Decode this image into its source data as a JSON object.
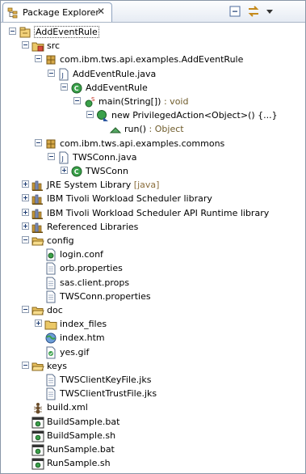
{
  "view": {
    "title": "Package Explorer",
    "close_glyph": "✕"
  },
  "toolbar": [
    "collapse-all-icon",
    "link-with-editor-icon",
    "view-menu-icon"
  ],
  "tree": [
    {
      "label": "AddEventRule",
      "icon": "project-icon",
      "expander": "minus",
      "selected": true
    },
    {
      "label": "src",
      "icon": "source-folder-icon",
      "expander": "minus"
    },
    {
      "label": "com.ibm.tws.api.examples.AddEventRule",
      "icon": "package-icon",
      "expander": "minus"
    },
    {
      "label": "AddEventRule.java",
      "icon": "java-file-icon",
      "expander": "minus"
    },
    {
      "label": "AddEventRule",
      "icon": "class-icon",
      "expander": "minus"
    },
    {
      "label": "main(String[])",
      "suffix": " : void",
      "icon": "static-method-icon",
      "expander": "minus"
    },
    {
      "label": "new PrivilegedAction<Object>() {...}",
      "icon": "anonymous-class-icon",
      "expander": "minus"
    },
    {
      "label": "run()",
      "suffix": " : Object",
      "icon": "method-icon",
      "expander": "none"
    },
    {
      "label": "com.ibm.tws.api.examples.commons",
      "icon": "package-icon",
      "expander": "minus"
    },
    {
      "label": "TWSConn.java",
      "icon": "java-file-icon",
      "expander": "minus"
    },
    {
      "label": "TWSConn",
      "icon": "class-icon",
      "expander": "plus"
    },
    {
      "label": "JRE System Library",
      "decoration": " [java]",
      "icon": "library-icon",
      "expander": "plus"
    },
    {
      "label": "IBM Tivoli Workload Scheduler library",
      "icon": "library-icon",
      "expander": "plus"
    },
    {
      "label": "IBM Tivoli Workload Scheduler API Runtime library",
      "icon": "library-icon",
      "expander": "plus"
    },
    {
      "label": "Referenced Libraries",
      "icon": "library-icon",
      "expander": "plus"
    },
    {
      "label": "config",
      "icon": "folder-open-icon",
      "expander": "minus"
    },
    {
      "label": "login.conf",
      "icon": "config-file-icon",
      "expander": "none"
    },
    {
      "label": "orb.properties",
      "icon": "text-file-icon",
      "expander": "none"
    },
    {
      "label": "sas.client.props",
      "icon": "text-file-icon",
      "expander": "none"
    },
    {
      "label": "TWSConn.properties",
      "icon": "text-file-icon",
      "expander": "none"
    },
    {
      "label": "doc",
      "icon": "folder-open-icon",
      "expander": "minus"
    },
    {
      "label": "index_files",
      "icon": "folder-icon",
      "expander": "plus"
    },
    {
      "label": "index.htm",
      "icon": "web-page-icon",
      "expander": "none"
    },
    {
      "label": "yes.gif",
      "icon": "image-file-icon",
      "expander": "none"
    },
    {
      "label": "keys",
      "icon": "folder-open-icon",
      "expander": "minus"
    },
    {
      "label": "TWSClientKeyFile.jks",
      "icon": "text-file-icon",
      "expander": "none"
    },
    {
      "label": "TWSClientTrustFile.jks",
      "icon": "text-file-icon",
      "expander": "none"
    },
    {
      "label": "build.xml",
      "icon": "ant-build-icon",
      "expander": "none"
    },
    {
      "label": "BuildSample.bat",
      "icon": "script-file-icon",
      "expander": "none"
    },
    {
      "label": "BuildSample.sh",
      "icon": "script-file-icon",
      "expander": "none"
    },
    {
      "label": "RunSample.bat",
      "icon": "script-file-icon",
      "expander": "none"
    },
    {
      "label": "RunSample.sh",
      "icon": "script-file-icon",
      "expander": "none"
    }
  ],
  "colors": {
    "accent": "#1d3c73",
    "folder": "#e9c46a",
    "package": "#c9a24a",
    "class": "#2f8f3a",
    "library": "#8a6d2b",
    "suffix": "#6e5b2a"
  }
}
